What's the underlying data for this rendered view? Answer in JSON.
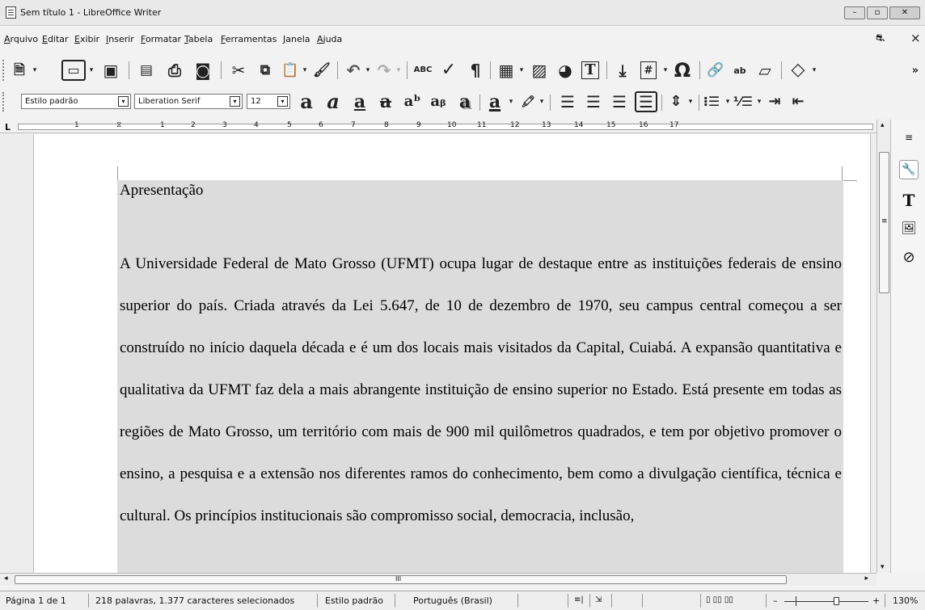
{
  "window": {
    "title": "Sem título 1 - LibreOffice Writer",
    "minimize": "–",
    "maximize": "▫",
    "close": "✕"
  },
  "menubar": {
    "items": [
      "Arquivo",
      "Editar",
      "Exibir",
      "Inserir",
      "Formatar",
      "Tabela",
      "Ferramentas",
      "Janela",
      "Ajuda"
    ],
    "right_icon": "⛐",
    "close": "×"
  },
  "standard_toolbar": {
    "icons": {
      "new": "🗎",
      "templates": "▭",
      "save": "▣",
      "export_pdf": "▤",
      "print": "⎙",
      "print_preview": "◙",
      "cut": "✂",
      "copy": "⧉",
      "paste": "📋",
      "clone": "🖌",
      "undo": "↶",
      "redo": "↷",
      "spelling": "ABC",
      "autocorrect": "✓",
      "formatting_marks": "¶",
      "table": "▦",
      "image": "▨",
      "chart": "◕",
      "textbox": "T",
      "page_break": "⤓",
      "field": "#",
      "special_char": "Ω",
      "hyperlink": "🔗",
      "footnote": "ab",
      "comment": "▱",
      "shapes": "◇",
      "more": "»",
      "dropdown": "▾"
    }
  },
  "formatting_toolbar": {
    "paragraph_style": "Estilo padrão",
    "font_name": "Liberation Serif",
    "font_size": "12",
    "combo_arrow": "▾",
    "icons": {
      "bold": "a",
      "italic": "a",
      "underline": "a",
      "strikethrough": "a",
      "superscript": "aᵇ",
      "subscript": "aᵦ",
      "shadow": "a",
      "font_color": "a",
      "highlight": "🖍",
      "align_left": "☰",
      "align_center": "☰",
      "align_right": "☰",
      "justify": "☰",
      "line_spacing": "⇕",
      "bullets": "⁝☰",
      "numbering": "⅟☰",
      "indent_increase": "⇥",
      "indent_decrease": "⇤",
      "dropdown": "▾"
    }
  },
  "ruler": {
    "tab_marker": "L",
    "numbers": [
      "1",
      "1",
      "2",
      "3",
      "4",
      "5",
      "6",
      "7",
      "8",
      "9",
      "10",
      "11",
      "12",
      "13",
      "14",
      "15",
      "16",
      "17"
    ]
  },
  "document": {
    "title": "Apresentação",
    "paragraph": "A Universidade Federal de Mato Grosso (UFMT) ocupa lugar de destaque entre as instituições federais de ensino superior do país. Criada através da Lei 5.647, de 10 de dezembro de 1970, seu campus central começou a ser construído no início daquela década e é um dos locais mais visitados da Capital, Cuiabá. A expansão quantitativa e qualitativa da UFMT faz dela a mais abrangente instituição de ensino superior no Estado. Está presente em todas as regiões de Mato Grosso, um território com mais de 900 mil quilômetros quadrados, e tem por objetivo promover o ensino, a pesquisa e a extensão nos diferentes ramos do conhecimento, bem como a divulgação científica, técnica e cultural. Os princípios institucionais são compromisso social, democracia, inclusão,"
  },
  "sidebar": {
    "icons": {
      "menu": "≡",
      "properties": "🔧",
      "styles": "T",
      "gallery": "🖼",
      "navigator": "⊘"
    }
  },
  "scrollbars": {
    "up": "▴",
    "down": "▾",
    "left": "◂",
    "right": "▸",
    "vthumb_grip": "≡",
    "hthumb_grip": "III"
  },
  "statusbar": {
    "page": "Página 1 de 1",
    "words": "218 palavras, 1.377 caracteres selecionados",
    "style": "Estilo padrão",
    "language": "Português (Brasil)",
    "insert_icon": "≡|",
    "selection_icon": "⇲",
    "layout_icons": "▯ ▯▯ ▯▯",
    "zoom_minus": "–",
    "zoom_plus": "+",
    "zoom": "130%"
  }
}
